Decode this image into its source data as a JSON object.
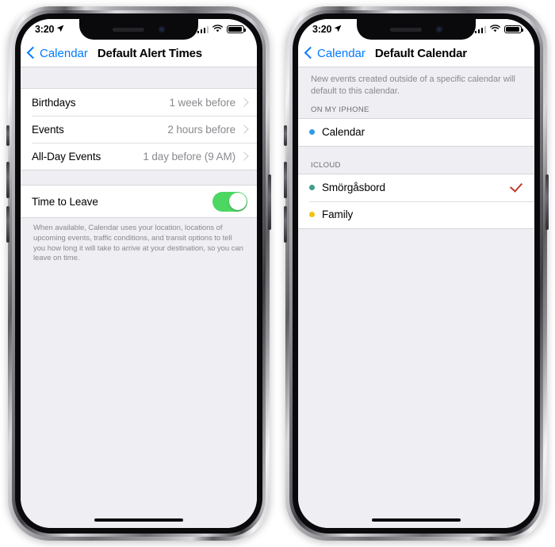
{
  "theme": {
    "accent_blue": "#007AFF",
    "toggle_green": "#4CD763",
    "checkmark_red": "#C0392B",
    "screen_bg": "#EFEEF3",
    "row_bg": "#FFFFFF",
    "secondary_text": "#8A8A8F"
  },
  "phones": [
    {
      "status_bar": {
        "time": "3:20",
        "location_arrow_icon": "location-arrow-icon",
        "signal_icon": "cellular-signal-icon",
        "wifi_icon": "wifi-icon",
        "battery_icon": "battery-icon"
      },
      "nav": {
        "back_icon": "chevron-left-icon",
        "back_label": "Calendar",
        "title": "Default Alert Times"
      },
      "alert_rows": [
        {
          "label": "Birthdays",
          "value": "1 week before",
          "chevron_icon": "chevron-right-icon"
        },
        {
          "label": "Events",
          "value": "2 hours before",
          "chevron_icon": "chevron-right-icon"
        },
        {
          "label": "All-Day Events",
          "value": "1 day before (9 AM)",
          "chevron_icon": "chevron-right-icon"
        }
      ],
      "toggle_row": {
        "label": "Time to Leave",
        "state": "on"
      },
      "footnote": "When available, Calendar uses your location, locations of upcoming events, traffic conditions, and transit options to tell you how long it will take to arrive at your destination, so you can leave on time."
    },
    {
      "status_bar": {
        "time": "3:20",
        "location_arrow_icon": "location-arrow-icon",
        "signal_icon": "cellular-signal-icon",
        "wifi_icon": "wifi-icon",
        "battery_icon": "battery-icon"
      },
      "nav": {
        "back_icon": "chevron-left-icon",
        "back_label": "Calendar",
        "title": "Default Calendar"
      },
      "description": "New events created outside of a specific calendar will default to this calendar.",
      "sections": [
        {
          "header": "ON MY IPHONE",
          "calendars": [
            {
              "name": "Calendar",
              "dot_color": "#2E9BE6",
              "selected": false
            }
          ]
        },
        {
          "header": "ICLOUD",
          "calendars": [
            {
              "name": "Smörgåsbord",
              "dot_color": "#3F9E8C",
              "selected": true
            },
            {
              "name": "Family",
              "dot_color": "#F1C40F",
              "selected": false
            }
          ]
        }
      ]
    }
  ]
}
